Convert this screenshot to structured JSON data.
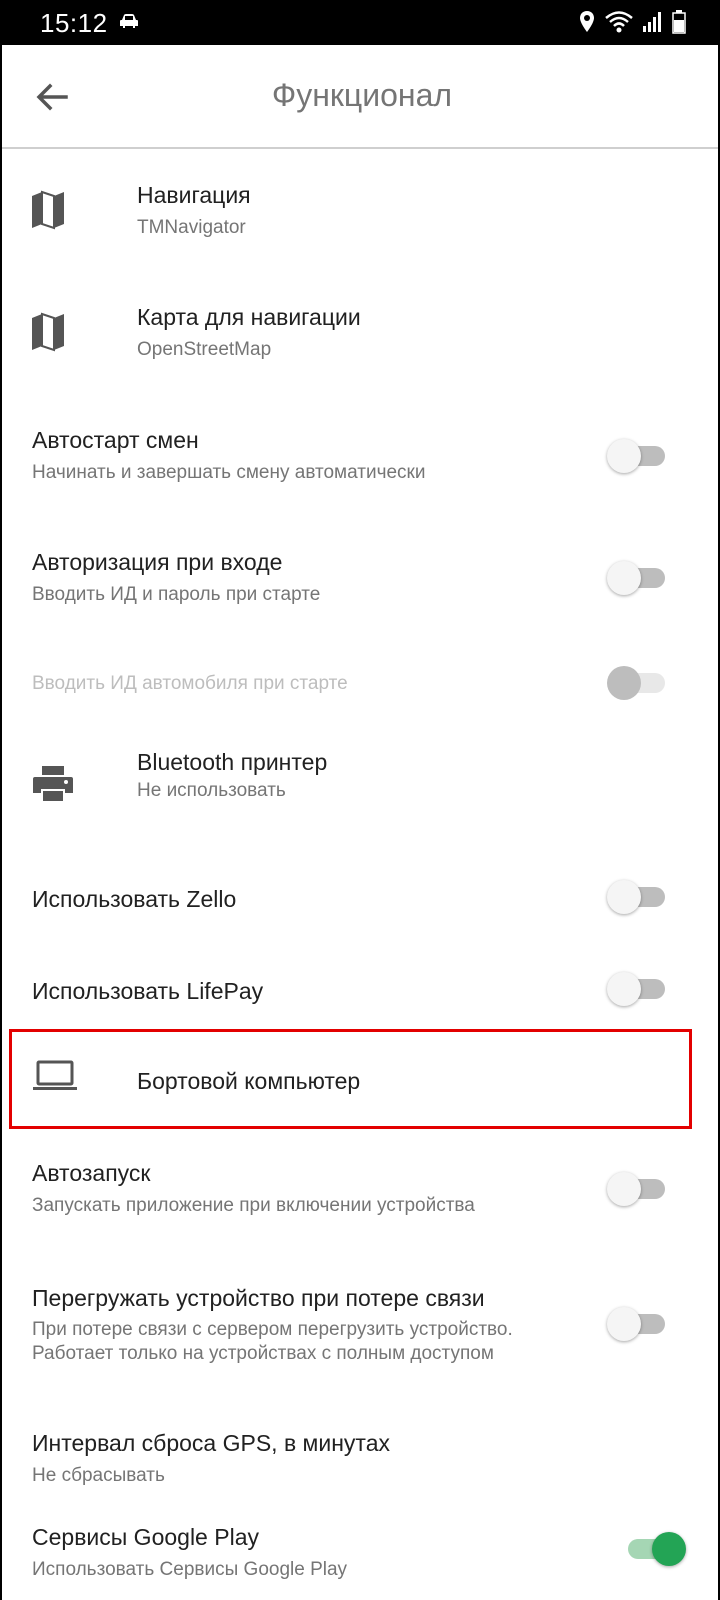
{
  "status_bar": {
    "time": "15:12",
    "icons": [
      "car-icon",
      "location-icon",
      "wifi-icon",
      "signal-icon",
      "battery-icon"
    ]
  },
  "app_bar": {
    "title": "Функционал",
    "back_icon": "arrow-back-icon"
  },
  "settings": [
    {
      "title": "Навигация",
      "subtitle": "TMNavigator",
      "icon": "map-icon"
    },
    {
      "title": "Карта для навигации",
      "subtitle": "OpenStreetMap",
      "icon": "map-icon"
    },
    {
      "title": "Автостарт смен",
      "subtitle": "Начинать и завершать смену автоматически",
      "toggle": false
    },
    {
      "title": "Авторизация при входе",
      "subtitle": "Вводить ИД и пароль при старте",
      "toggle": false
    },
    {
      "title": "Вводить ИД автомобиля при старте",
      "toggle": false,
      "disabled": true
    },
    {
      "title": "Bluetooth принтер",
      "subtitle": "Не использовать",
      "icon": "printer-icon"
    },
    {
      "title": "Использовать Zello",
      "toggle": false
    },
    {
      "title": "Использовать LifePay",
      "toggle": false
    },
    {
      "title": "Бортовой компьютер",
      "icon": "laptop-icon",
      "highlighted": true
    },
    {
      "title": "Автозапуск",
      "subtitle": "Запускать приложение при включении устройства",
      "toggle": false
    },
    {
      "title": "Перегружать устройство при потере связи",
      "subtitle_lines": [
        "При потере связи с сервером перегрузить устройство.",
        "Работает только на устройствах с полным доступом"
      ],
      "toggle": false
    },
    {
      "title": "Интервал сброса GPS, в минутах",
      "subtitle": "Не сбрасывать"
    },
    {
      "title": "Сервисы Google Play",
      "subtitle": "Использовать Сервисы Google Play",
      "toggle": true
    }
  ],
  "colors": {
    "accent": "#23a455",
    "highlight_border": "#e30000",
    "primary_text": "#212121",
    "secondary_text": "#757575"
  }
}
